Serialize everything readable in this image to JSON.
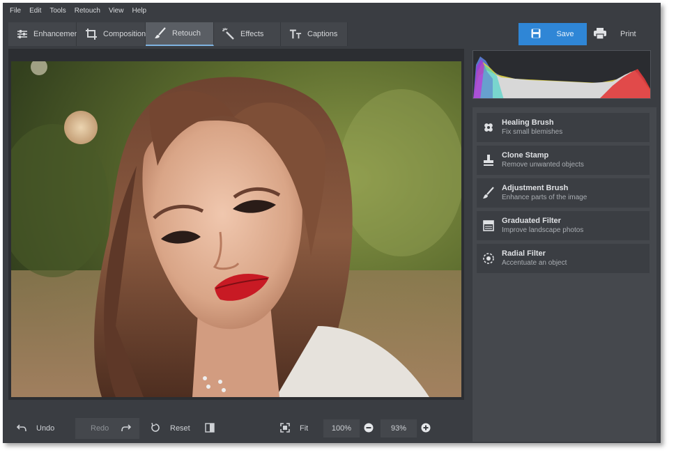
{
  "menu": [
    "File",
    "Edit",
    "Tools",
    "Retouch",
    "View",
    "Help"
  ],
  "tabs": [
    {
      "label": "Enhancement",
      "icon": "enhancement-icon"
    },
    {
      "label": "Composition",
      "icon": "crop-icon"
    },
    {
      "label": "Retouch",
      "icon": "brush-icon"
    },
    {
      "label": "Effects",
      "icon": "magic-wand-icon"
    },
    {
      "label": "Captions",
      "icon": "text-icon"
    }
  ],
  "actions": {
    "save": "Save",
    "print": "Print"
  },
  "retouch_tools": [
    {
      "title": "Healing Brush",
      "desc": "Fix small blemishes",
      "icon": "healing-brush-icon"
    },
    {
      "title": "Clone Stamp",
      "desc": "Remove unwanted objects",
      "icon": "clone-stamp-icon"
    },
    {
      "title": "Adjustment Brush",
      "desc": "Enhance parts of the image",
      "icon": "adjustment-brush-icon"
    },
    {
      "title": "Graduated Filter",
      "desc": "Improve landscape photos",
      "icon": "graduated-filter-icon"
    },
    {
      "title": "Radial Filter",
      "desc": "Accentuate an object",
      "icon": "radial-filter-icon"
    }
  ],
  "bottom": {
    "undo": "Undo",
    "redo": "Redo",
    "reset": "Reset",
    "fit": "Fit",
    "zoom_preset": "100%",
    "zoom_level": "93%"
  },
  "colors": {
    "accent": "#2f86d6",
    "background": "#3a3d42",
    "panel": "#45484d",
    "lips": "#c81a24"
  }
}
